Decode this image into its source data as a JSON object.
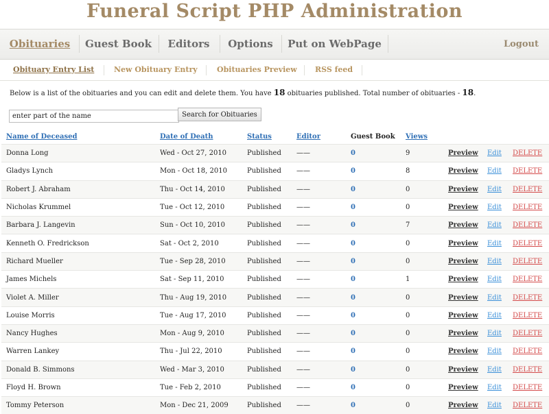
{
  "title": "Funeral Script PHP Administration",
  "nav": {
    "items": [
      "Obituaries",
      "Guest Book",
      "Editors",
      "Options",
      "Put on WebPage"
    ],
    "logout": "Logout"
  },
  "subnav": {
    "items": [
      "Obituary Entry List",
      "New Obituary Entry",
      "Obituaries Preview",
      "RSS feed"
    ]
  },
  "intro": {
    "text1": "Below is a list of the obituaries and you can edit and delete them. You have ",
    "published_count": "18",
    "text2": " obituaries published. Total number of obituaries - ",
    "total_count": "18",
    "text3": "."
  },
  "search": {
    "placeholder": "enter part of the name",
    "button": "Search for Obituaries"
  },
  "table": {
    "headers": {
      "name": "Name of Deceased",
      "date": "Date of Death",
      "status": "Status",
      "editor": "Editor",
      "guestbook": "Guest Book",
      "views": "Views"
    },
    "actions": {
      "preview": "Preview",
      "edit": "Edit",
      "delete": "DELETE"
    },
    "rows": [
      {
        "name": "Donna Long",
        "date": "Wed - Oct 27, 2010",
        "status": "Published",
        "editor": "——",
        "guestbook": "0",
        "views": "9"
      },
      {
        "name": "Gladys Lynch",
        "date": "Mon - Oct 18, 2010",
        "status": "Published",
        "editor": "——",
        "guestbook": "0",
        "views": "8"
      },
      {
        "name": "Robert J. Abraham",
        "date": "Thu - Oct 14, 2010",
        "status": "Published",
        "editor": "——",
        "guestbook": "0",
        "views": "0"
      },
      {
        "name": "Nicholas Krummel",
        "date": "Tue - Oct 12, 2010",
        "status": "Published",
        "editor": "——",
        "guestbook": "0",
        "views": "0"
      },
      {
        "name": "Barbara J. Langevin",
        "date": "Sun - Oct 10, 2010",
        "status": "Published",
        "editor": "——",
        "guestbook": "0",
        "views": "7"
      },
      {
        "name": "Kenneth O. Fredrickson",
        "date": "Sat - Oct 2, 2010",
        "status": "Published",
        "editor": "——",
        "guestbook": "0",
        "views": "0"
      },
      {
        "name": "Richard Mueller",
        "date": "Tue - Sep 28, 2010",
        "status": "Published",
        "editor": "——",
        "guestbook": "0",
        "views": "0"
      },
      {
        "name": "James Michels",
        "date": "Sat - Sep 11, 2010",
        "status": "Published",
        "editor": "——",
        "guestbook": "0",
        "views": "1"
      },
      {
        "name": "Violet A. Miller",
        "date": "Thu - Aug 19, 2010",
        "status": "Published",
        "editor": "——",
        "guestbook": "0",
        "views": "0"
      },
      {
        "name": "Louise Morris",
        "date": "Tue - Aug 17, 2010",
        "status": "Published",
        "editor": "——",
        "guestbook": "0",
        "views": "0"
      },
      {
        "name": "Nancy Hughes",
        "date": "Mon - Aug 9, 2010",
        "status": "Published",
        "editor": "——",
        "guestbook": "0",
        "views": "0"
      },
      {
        "name": "Warren Lankey",
        "date": "Thu - Jul 22, 2010",
        "status": "Published",
        "editor": "——",
        "guestbook": "0",
        "views": "0"
      },
      {
        "name": "Donald B. Simmons",
        "date": "Wed - Mar 3, 2010",
        "status": "Published",
        "editor": "——",
        "guestbook": "0",
        "views": "0"
      },
      {
        "name": "Floyd H. Brown",
        "date": "Tue - Feb 2, 2010",
        "status": "Published",
        "editor": "——",
        "guestbook": "0",
        "views": "0"
      },
      {
        "name": "Tommy Peterson",
        "date": "Mon - Dec 21, 2009",
        "status": "Published",
        "editor": "——",
        "guestbook": "0",
        "views": "0"
      }
    ]
  },
  "colors": {
    "title": "#a48a66",
    "link": "#2f6fb5",
    "delete": "#d44a4a",
    "subnav": "#b89560"
  }
}
